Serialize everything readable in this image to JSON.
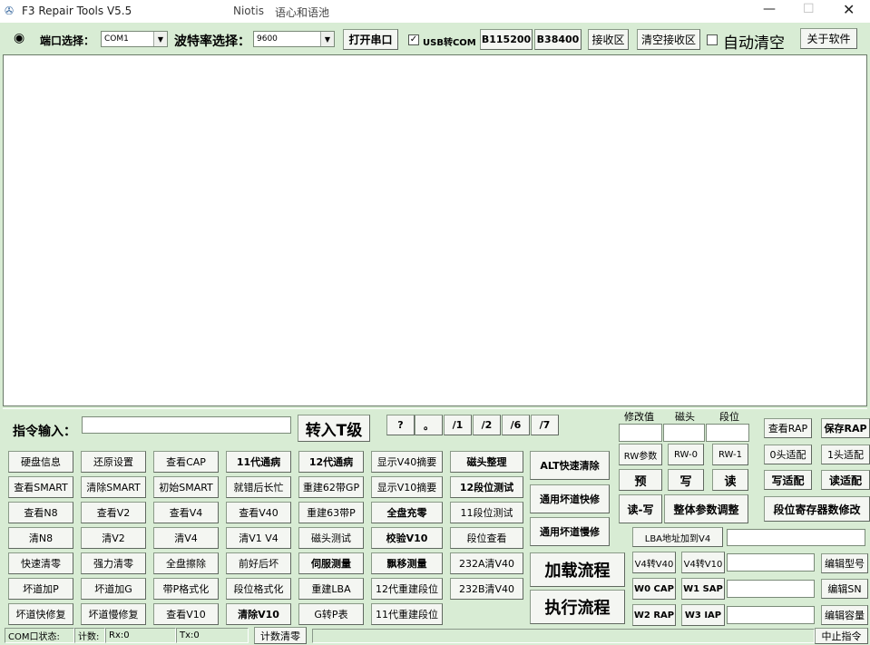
{
  "window": {
    "title": "F3 Repair Tools V5.5",
    "subtitle": "Niotis",
    "subtitle2": "语心和语池"
  },
  "toolbar": {
    "port_label": "端口选择：",
    "port_value": "COM1",
    "baud_label": "波特率选择：",
    "baud_value": "9600",
    "open_port": "打开串口",
    "usb_label": "USB转COM",
    "b115200": "B115200",
    "b38400": "B38400",
    "receive": "接收区",
    "clear_receive": "清空接收区",
    "auto_clear": "自动清空",
    "about": "关于软件"
  },
  "cmd": {
    "label": "指令输入：",
    "to_t": "转入T级",
    "q": "?",
    "dot": "。",
    "s1": "/1",
    "s2": "/2",
    "s6": "/6",
    "s7": "/7"
  },
  "grid": {
    "c1": [
      "硬盘信息",
      "查看SMART",
      "查看N8",
      "清N8",
      "快速清零",
      "坏道加P",
      "坏道快修复"
    ],
    "c2": [
      "还原设置",
      "清除SMART",
      "查看V2",
      "清V2",
      "强力清零",
      "坏道加G",
      "坏道慢修复"
    ],
    "c3": [
      "查看CAP",
      "初始SMART",
      "查看V4",
      "清V4",
      "全盘擦除",
      "带P格式化",
      "查看V10"
    ],
    "c4": [
      "11代通病",
      "就错后长忙",
      "查看V40",
      "清V1 V4",
      "前好后坏",
      "段位格式化",
      "清除V10"
    ],
    "c5": [
      "12代通病",
      "重建62带GP",
      "重建63带P",
      "磁头测试",
      "伺服测量",
      "重建LBA",
      "G转P表"
    ],
    "c6": [
      "显示V40摘要",
      "显示V10摘要",
      "全盘充零",
      "校验V10",
      "飘移测量",
      "12代重建段位",
      "11代重建段位"
    ],
    "c7": [
      "磁头整理",
      "12段位测试",
      "11段位测试",
      "段位查看",
      "232A清V40",
      "232B清V40"
    ]
  },
  "mid": {
    "alt": "ALT快速清除",
    "fast": "通用坏道快修",
    "slow": "通用坏道慢修",
    "load": "加载流程",
    "exec": "执行流程"
  },
  "right": {
    "modval": "修改值",
    "head": "磁头",
    "seg": "段位",
    "rw": "RW参数",
    "rw0": "RW-0",
    "rw1": "RW-1",
    "pre": "预",
    "write": "写",
    "read": "读",
    "rwrite": "读-写",
    "adjust": "整体参数调整",
    "lba": "LBA地址加到V4",
    "v4v40": "V4转V40",
    "v4v10": "V4转V10",
    "w0": "W0 CAP",
    "w1": "W1 SAP",
    "w2": "W2 RAP",
    "w3": "W3 IAP",
    "viewrap": "查看RAP",
    "saverap": "保存RAP",
    "h0": "0头适配",
    "h1": "1头适配",
    "wadapt": "写适配",
    "radapt": "读适配",
    "segreg": "段位寄存器数修改",
    "model": "编辑型号",
    "sn": "编辑SN",
    "cap": "编辑容量"
  },
  "status": {
    "com": "COM口状态:",
    "count": "计数:",
    "rx": "Rx:0",
    "tx": "Tx:0",
    "reset": "计数清零",
    "stop": "中止指令"
  }
}
